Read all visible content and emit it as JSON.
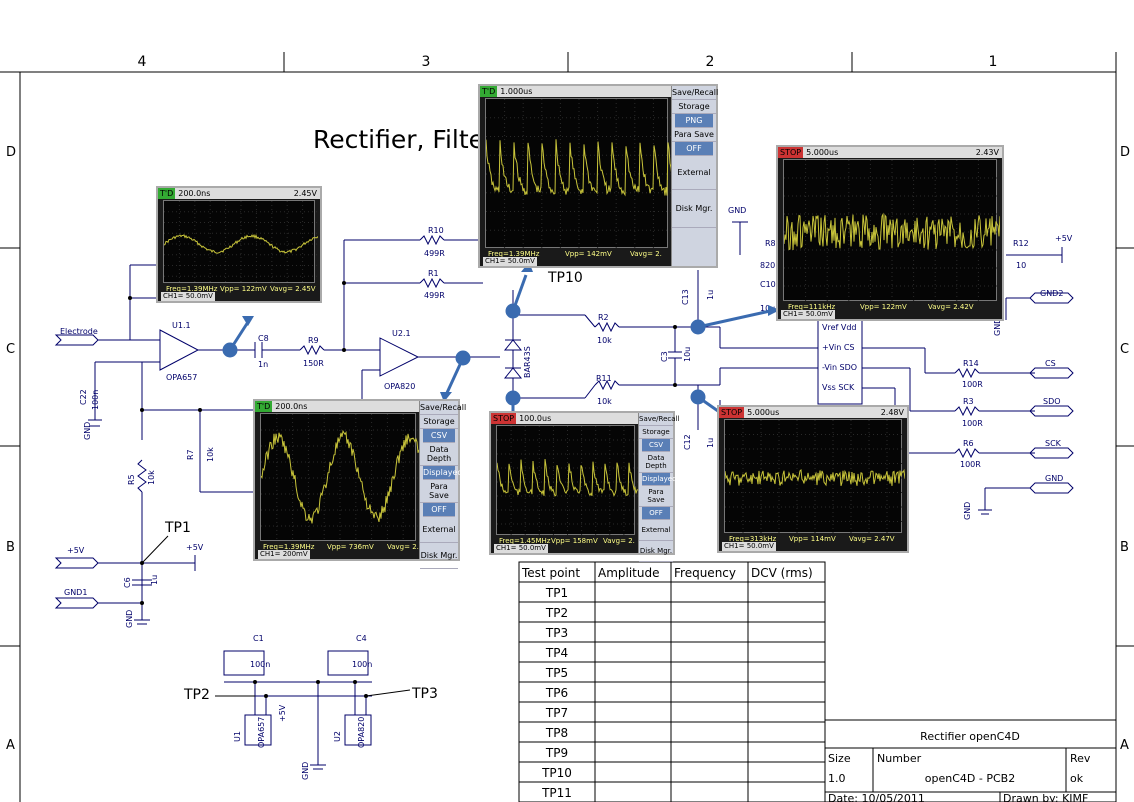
{
  "border": {
    "columns": [
      "4",
      "3",
      "2",
      "1"
    ],
    "rows": [
      "D",
      "C",
      "B",
      "A"
    ]
  },
  "title": "Rectifier, Filter, openC4D)",
  "labels": {
    "electrode": "Electrode",
    "c22": "C22",
    "c22v": "100n",
    "gnd": "GND",
    "u11": "U1.1",
    "opa657": "OPA657",
    "c8": "C8",
    "c8v": "1n",
    "r9": "R9",
    "r9v": "150R",
    "u21": "U2.1",
    "opa820": "OPA820",
    "r10": "R10",
    "r10v": "499R",
    "r1": "R1",
    "r1v": "499R",
    "r7": "R7",
    "r7v": "10k",
    "r5": "R5",
    "r5v": "10k",
    "p5v": "+5V",
    "c6": "C6",
    "c6v": "1u",
    "gnd1": "GND1",
    "c1": "C1",
    "c1v": "100n",
    "c4": "C4",
    "c4v": "100n",
    "u1": "U1",
    "u2": "U2",
    "bar": "BAR43S",
    "r2": "R2",
    "r2v": "10k",
    "r11": "R11",
    "r11v": "10k",
    "c3": "C3",
    "c3v": "10u",
    "c13": "C13",
    "c13v": "1u",
    "c12": "C12",
    "c12v": "1u",
    "c10": "C10",
    "c10v": "10u",
    "r8": "R8",
    "r8v": "820",
    "r12": "R12",
    "r12v": "10",
    "gnd2": "GND2",
    "r14": "R14",
    "r14v": "100R",
    "r3": "R3",
    "r3v": "100R",
    "r6": "R6",
    "r6v": "100R",
    "cs": "CS",
    "sdo": "SDO",
    "sck": "SCK",
    "vref": "Vref Vdd",
    "vin_p": "+Vin  CS",
    "vin_m": "-Vin SDO",
    "vss": "Vss  SCK"
  },
  "testpoints": {
    "tp1": "TP1",
    "tp2": "TP2",
    "tp3": "TP3",
    "tp10": "TP10"
  },
  "table": {
    "headers": [
      "Test point",
      "Amplitude",
      "Frequency",
      "DCV (rms)"
    ],
    "rows": [
      "TP1",
      "TP2",
      "TP3",
      "TP4",
      "TP5",
      "TP6",
      "TP7",
      "TP8",
      "TP9",
      "TP10",
      "TP11"
    ]
  },
  "title_block": {
    "name": "Rectifier openC4D",
    "size_label": "Size",
    "size": "1.0",
    "number_label": "Number",
    "number": "openC4D - PCB2",
    "rev_label": "Rev",
    "rev": "ok",
    "date": "Date: 10/05/2011",
    "drawn": "Drawn by: KJMF"
  },
  "scopes": [
    {
      "tag": "T'D",
      "timebase": "200.0ns",
      "right": "2.45V",
      "freq": "Freq=1.39MHz",
      "vpp": "Vpp= 122mV",
      "vavg": "Vavg= 2.45V",
      "ch": "CH1= 50.0mV"
    },
    {
      "tag": "T'D",
      "timebase": "1.000us",
      "right": "",
      "freq": "Freq=1.39MHz",
      "vpp": "Vpp= 142mV",
      "vavg": "Vavg= 2.",
      "ch": "CH1= 50.0mV",
      "menu": [
        "Save/Recall",
        "Storage",
        "PNG",
        "Para Save",
        "OFF",
        "External",
        "Disk Mgr."
      ]
    },
    {
      "tag": "T'D",
      "timebase": "200.0ns",
      "right": "",
      "freq": "Freq=1.39MHz",
      "vpp": "Vpp= 736mV",
      "vavg": "Vavg= 2.",
      "ch": "CH1= 200mV",
      "menu": [
        "Save/Recall",
        "Storage",
        "CSV",
        "Data Depth",
        "Displayed",
        "Para Save",
        "OFF",
        "External",
        "Disk Mgr."
      ]
    },
    {
      "tag": "STOP",
      "timebase": "100.0us",
      "right": "",
      "freq": "Freq=1.45MHz",
      "vpp": "Vpp= 158mV",
      "vavg": "Vavg= 2.",
      "ch": "CH1= 50.0mV",
      "menu": [
        "Save/Recall",
        "Storage",
        "CSV",
        "Data Depth",
        "Displayed",
        "Para Save",
        "OFF",
        "External",
        "Disk Mgr."
      ]
    },
    {
      "tag": "STOP",
      "timebase": "5.000us",
      "right": "2.43V",
      "freq": "Freq=111kHz",
      "vpp": "Vpp= 122mV",
      "vavg": "Vavg= 2.42V",
      "ch": "CH1= 50.0mV"
    },
    {
      "tag": "STOP",
      "timebase": "5.000us",
      "right": "2.48V",
      "freq": "Freq=313kHz",
      "vpp": "Vpp= 114mV",
      "vavg": "Vavg= 2.47V",
      "ch": "CH1= 50.0mV"
    }
  ]
}
